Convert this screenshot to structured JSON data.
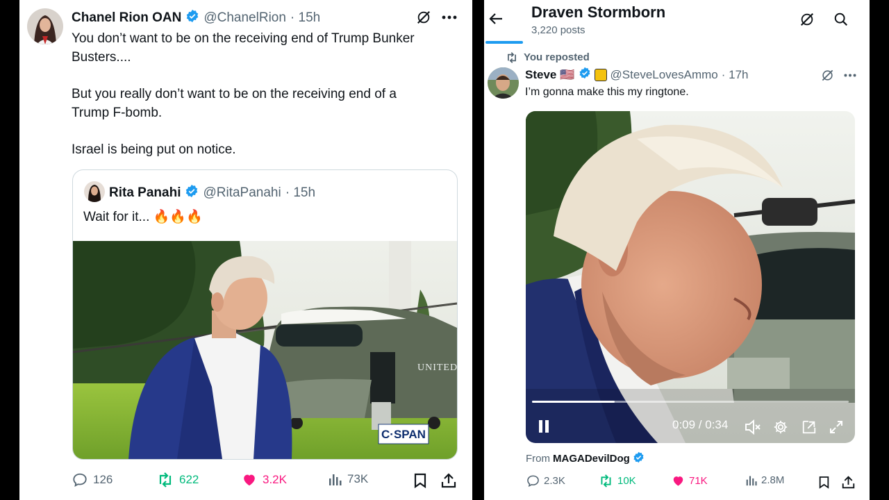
{
  "left_tweet": {
    "author_name": "Chanel Rion OAN",
    "handle": "@ChanelRion",
    "time": "· 15h",
    "text_lines": [
      "You don’t want to be on the receiving end of Trump Bunker",
      "Busters...."
    ],
    "text_p2": [
      "But you really don’t want to be on the receiving end of a",
      "Trump F-bomb."
    ],
    "text_p3": "Israel is being put on notice.",
    "quote": {
      "author_name": "Rita Panahi",
      "handle": "@RitaPanahi",
      "time": "· 15h",
      "text": "Wait for it...",
      "emoji": "🔥🔥🔥",
      "media_watermark": "C·SPAN",
      "heli_text": "UNITED"
    },
    "stats": {
      "replies": "126",
      "reposts": "622",
      "likes": "3.2K",
      "views": "73K"
    }
  },
  "right_panel": {
    "header": {
      "title": "Draven Stormborn",
      "subtitle": "3,220 posts"
    },
    "repost_label": "You reposted",
    "tweet": {
      "author_name": "Steve",
      "flag": "🇺🇸",
      "handle": "@SteveLovesAmmo",
      "time": "· 17h",
      "text": "I’m gonna make this my ringtone.",
      "video_time": "0:09 / 0:34",
      "video_progress": 0.26,
      "from_prefix": "From ",
      "from_source": "MAGADevilDog",
      "stats": {
        "replies": "2.3K",
        "reposts": "10K",
        "likes": "71K",
        "views": "2.8M"
      }
    }
  },
  "colors": {
    "repost_green": "#00ba7c",
    "like_pink": "#f91880",
    "verified_blue": "#1d9bf0",
    "muted": "#536471"
  }
}
